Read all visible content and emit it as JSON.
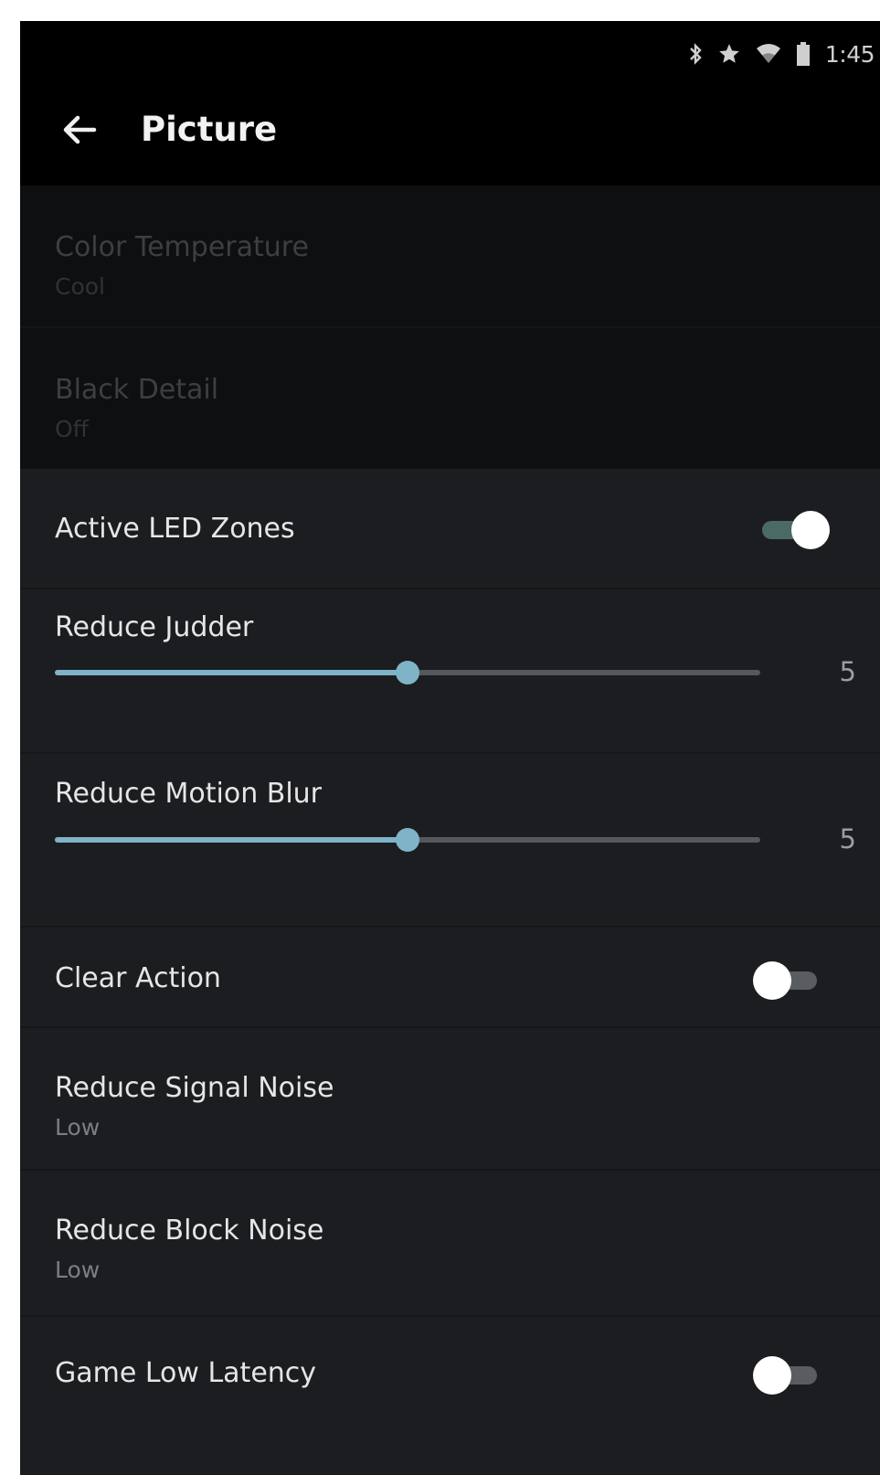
{
  "status_bar": {
    "icons": [
      "bluetooth-icon",
      "star-icon",
      "wifi-icon",
      "battery-icon"
    ],
    "time": "1:45"
  },
  "header": {
    "back_icon": "arrow-left-icon",
    "title": "Picture"
  },
  "settings": {
    "color_temperature": {
      "label": "Color Temperature",
      "value": "Cool",
      "enabled": false
    },
    "black_detail": {
      "label": "Black Detail",
      "value": "Off",
      "enabled": false
    },
    "active_led_zones": {
      "label": "Active LED Zones",
      "on": true
    },
    "reduce_judder": {
      "label": "Reduce Judder",
      "value": "5",
      "level": 0.5
    },
    "reduce_motion_blur": {
      "label": "Reduce Motion Blur",
      "value": "5",
      "level": 0.5
    },
    "clear_action": {
      "label": "Clear Action",
      "on": false
    },
    "reduce_signal_noise": {
      "label": "Reduce Signal Noise",
      "value": "Low"
    },
    "reduce_block_noise": {
      "label": "Reduce Block Noise",
      "value": "Low"
    },
    "game_low_latency": {
      "label": "Game Low Latency",
      "on": false
    }
  },
  "colors": {
    "accent": "#7fb3c8",
    "toggle_on_track": "#4c6a64",
    "background": "#1b1d20",
    "header": "#000000"
  }
}
